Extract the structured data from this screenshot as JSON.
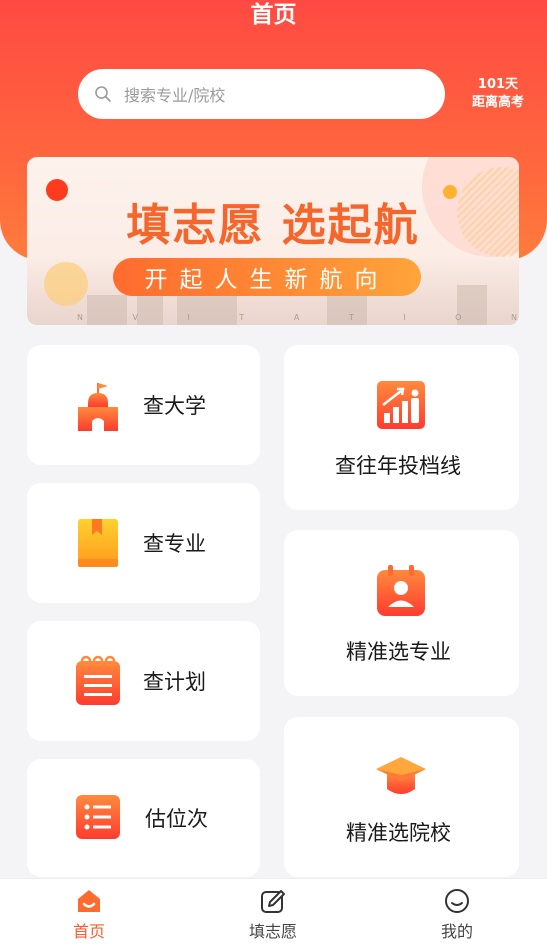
{
  "header": {
    "title": "首页",
    "search_placeholder": "搜索专业/院校",
    "countdown_days": "101天",
    "countdown_label": "距离高考"
  },
  "banner": {
    "headline": "填志愿 选起航",
    "subline": "开起人生新航向",
    "letters": [
      "N",
      "V",
      "I",
      "T",
      "A",
      "T",
      "I",
      "O",
      "N"
    ]
  },
  "cards": {
    "university": "查大学",
    "major": "查专业",
    "plan": "查计划",
    "rank": "估位次",
    "past_scores": "查往年投档线",
    "precise_major": "精准选专业",
    "precise_college": "精准选院校"
  },
  "tabs": {
    "home": "首页",
    "apply": "填志愿",
    "mine": "我的"
  },
  "colors": {
    "brand": "#ff4a43",
    "accent": "#ff5a2e",
    "icon_gradient_top": "#ff8a3d",
    "icon_gradient_bottom": "#ff3b2f"
  }
}
